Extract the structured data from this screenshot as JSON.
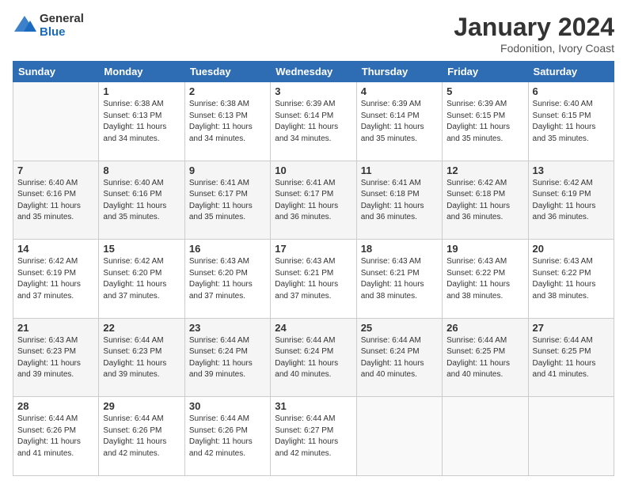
{
  "logo": {
    "general": "General",
    "blue": "Blue"
  },
  "header": {
    "title": "January 2024",
    "subtitle": "Fodonition, Ivory Coast"
  },
  "days_of_week": [
    "Sunday",
    "Monday",
    "Tuesday",
    "Wednesday",
    "Thursday",
    "Friday",
    "Saturday"
  ],
  "weeks": [
    [
      {
        "day": "",
        "info": ""
      },
      {
        "day": "1",
        "info": "Sunrise: 6:38 AM\nSunset: 6:13 PM\nDaylight: 11 hours\nand 34 minutes."
      },
      {
        "day": "2",
        "info": "Sunrise: 6:38 AM\nSunset: 6:13 PM\nDaylight: 11 hours\nand 34 minutes."
      },
      {
        "day": "3",
        "info": "Sunrise: 6:39 AM\nSunset: 6:14 PM\nDaylight: 11 hours\nand 34 minutes."
      },
      {
        "day": "4",
        "info": "Sunrise: 6:39 AM\nSunset: 6:14 PM\nDaylight: 11 hours\nand 35 minutes."
      },
      {
        "day": "5",
        "info": "Sunrise: 6:39 AM\nSunset: 6:15 PM\nDaylight: 11 hours\nand 35 minutes."
      },
      {
        "day": "6",
        "info": "Sunrise: 6:40 AM\nSunset: 6:15 PM\nDaylight: 11 hours\nand 35 minutes."
      }
    ],
    [
      {
        "day": "7",
        "info": "Sunrise: 6:40 AM\nSunset: 6:16 PM\nDaylight: 11 hours\nand 35 minutes."
      },
      {
        "day": "8",
        "info": "Sunrise: 6:40 AM\nSunset: 6:16 PM\nDaylight: 11 hours\nand 35 minutes."
      },
      {
        "day": "9",
        "info": "Sunrise: 6:41 AM\nSunset: 6:17 PM\nDaylight: 11 hours\nand 35 minutes."
      },
      {
        "day": "10",
        "info": "Sunrise: 6:41 AM\nSunset: 6:17 PM\nDaylight: 11 hours\nand 36 minutes."
      },
      {
        "day": "11",
        "info": "Sunrise: 6:41 AM\nSunset: 6:18 PM\nDaylight: 11 hours\nand 36 minutes."
      },
      {
        "day": "12",
        "info": "Sunrise: 6:42 AM\nSunset: 6:18 PM\nDaylight: 11 hours\nand 36 minutes."
      },
      {
        "day": "13",
        "info": "Sunrise: 6:42 AM\nSunset: 6:19 PM\nDaylight: 11 hours\nand 36 minutes."
      }
    ],
    [
      {
        "day": "14",
        "info": "Sunrise: 6:42 AM\nSunset: 6:19 PM\nDaylight: 11 hours\nand 37 minutes."
      },
      {
        "day": "15",
        "info": "Sunrise: 6:42 AM\nSunset: 6:20 PM\nDaylight: 11 hours\nand 37 minutes."
      },
      {
        "day": "16",
        "info": "Sunrise: 6:43 AM\nSunset: 6:20 PM\nDaylight: 11 hours\nand 37 minutes."
      },
      {
        "day": "17",
        "info": "Sunrise: 6:43 AM\nSunset: 6:21 PM\nDaylight: 11 hours\nand 37 minutes."
      },
      {
        "day": "18",
        "info": "Sunrise: 6:43 AM\nSunset: 6:21 PM\nDaylight: 11 hours\nand 38 minutes."
      },
      {
        "day": "19",
        "info": "Sunrise: 6:43 AM\nSunset: 6:22 PM\nDaylight: 11 hours\nand 38 minutes."
      },
      {
        "day": "20",
        "info": "Sunrise: 6:43 AM\nSunset: 6:22 PM\nDaylight: 11 hours\nand 38 minutes."
      }
    ],
    [
      {
        "day": "21",
        "info": "Sunrise: 6:43 AM\nSunset: 6:23 PM\nDaylight: 11 hours\nand 39 minutes."
      },
      {
        "day": "22",
        "info": "Sunrise: 6:44 AM\nSunset: 6:23 PM\nDaylight: 11 hours\nand 39 minutes."
      },
      {
        "day": "23",
        "info": "Sunrise: 6:44 AM\nSunset: 6:24 PM\nDaylight: 11 hours\nand 39 minutes."
      },
      {
        "day": "24",
        "info": "Sunrise: 6:44 AM\nSunset: 6:24 PM\nDaylight: 11 hours\nand 40 minutes."
      },
      {
        "day": "25",
        "info": "Sunrise: 6:44 AM\nSunset: 6:24 PM\nDaylight: 11 hours\nand 40 minutes."
      },
      {
        "day": "26",
        "info": "Sunrise: 6:44 AM\nSunset: 6:25 PM\nDaylight: 11 hours\nand 40 minutes."
      },
      {
        "day": "27",
        "info": "Sunrise: 6:44 AM\nSunset: 6:25 PM\nDaylight: 11 hours\nand 41 minutes."
      }
    ],
    [
      {
        "day": "28",
        "info": "Sunrise: 6:44 AM\nSunset: 6:26 PM\nDaylight: 11 hours\nand 41 minutes."
      },
      {
        "day": "29",
        "info": "Sunrise: 6:44 AM\nSunset: 6:26 PM\nDaylight: 11 hours\nand 42 minutes."
      },
      {
        "day": "30",
        "info": "Sunrise: 6:44 AM\nSunset: 6:26 PM\nDaylight: 11 hours\nand 42 minutes."
      },
      {
        "day": "31",
        "info": "Sunrise: 6:44 AM\nSunset: 6:27 PM\nDaylight: 11 hours\nand 42 minutes."
      },
      {
        "day": "",
        "info": ""
      },
      {
        "day": "",
        "info": ""
      },
      {
        "day": "",
        "info": ""
      }
    ]
  ]
}
